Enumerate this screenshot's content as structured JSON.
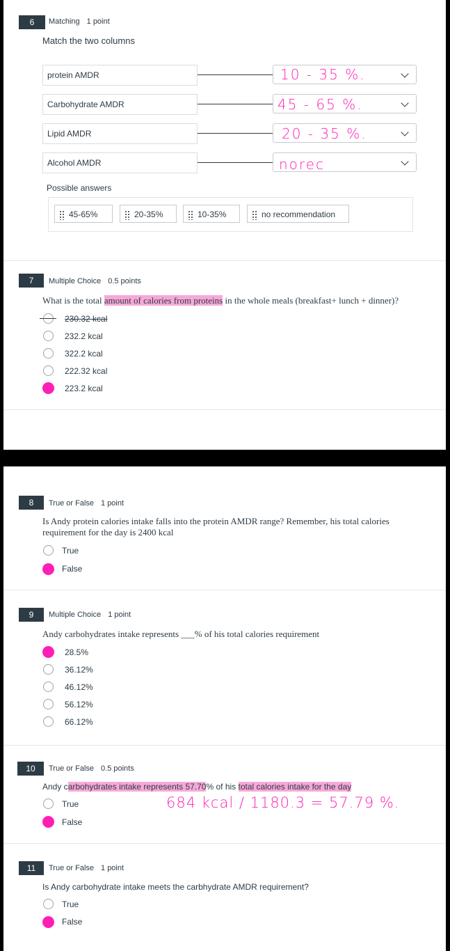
{
  "q6": {
    "number": "6",
    "type": "Matching",
    "points": "1 point",
    "prompt": "Match the two columns",
    "rows": [
      {
        "left": "protein AMDR",
        "answer": "10 - 35 %."
      },
      {
        "left": "Carbohydrate AMDR",
        "answer": "45 - 65 %."
      },
      {
        "left": "Lipid AMDR",
        "answer": "20 - 35 %."
      },
      {
        "left": "Alcohol AMDR",
        "answer": "norec"
      }
    ],
    "possible_label": "Possible answers",
    "chips": [
      "45-65%",
      "20-35%",
      "10-35%",
      "no recommendation"
    ]
  },
  "q7": {
    "number": "7",
    "type": "Multiple Choice",
    "points": "0.5 points",
    "stem_before": "What is the total ",
    "stem_highlight": "amount of calories from proteins",
    "stem_after": " in the whole meals (breakfast+ lunch + dinner)?",
    "options": [
      "230.32 kcal",
      "232.2 kcal",
      "322.2 kcal",
      "222.32 kcal",
      "223.2 kcal"
    ],
    "crossed_option": "230.32 kcal",
    "selected": "223.2 kcal"
  },
  "q8": {
    "number": "8",
    "type": "True or False",
    "points": "1 point",
    "stem_line1": "Is Andy protein calories intake falls into the protein AMDR range? Remember, his total calories",
    "stem_line2": "requirement for the day is 2400 kcal",
    "options": [
      "True",
      "False"
    ],
    "selected": "False"
  },
  "q9": {
    "number": "9",
    "type": "Multiple Choice",
    "points": "1 point",
    "stem": "Andy carbohydrates intake represents ___% of his total calories requirement",
    "options": [
      "28.5%",
      "36.12%",
      "46.12%",
      "56.12%",
      "66.12%"
    ],
    "selected": "28.5%"
  },
  "q10": {
    "number": "10",
    "type": "True or False",
    "points": "0.5 points",
    "stem_a": "Andy c",
    "stem_hl1": "arbohydrates intake represents 57.70",
    "stem_b": "% of his ",
    "stem_hl2": "total calories intake for the day",
    "handwriting": "684 kcal / 1180.3 = 57.79 %.",
    "options": [
      "True",
      "False"
    ],
    "selected": "False"
  },
  "q11": {
    "number": "11",
    "type": "True or False",
    "points": "1 point",
    "stem": "Is Andy carbohydrate intake meets the carbhydrate AMDR requirement?",
    "options": [
      "True",
      "False"
    ],
    "selected": "False"
  },
  "colors": {
    "accent_pink": "#ff1fb4",
    "highlight": "#f7a8d8",
    "badge": "#2d3b45"
  }
}
